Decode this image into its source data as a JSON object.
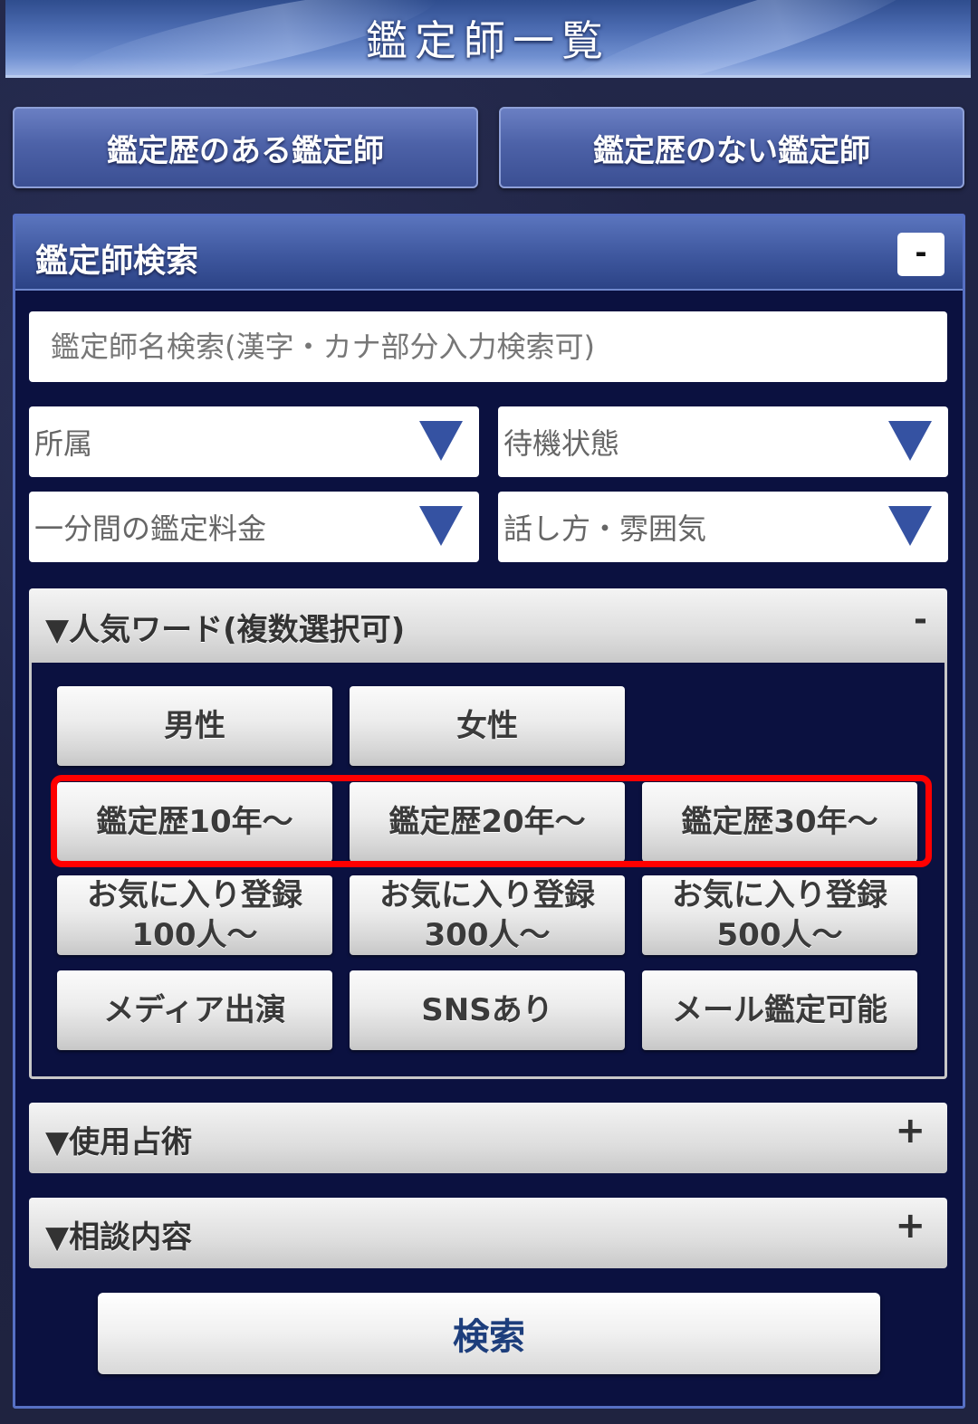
{
  "header": {
    "title": "鑑定師一覧"
  },
  "tabs": {
    "with_history": "鑑定歴のある鑑定師",
    "without_history": "鑑定歴のない鑑定師"
  },
  "search_panel": {
    "title": "鑑定師検索",
    "collapse_label": "-",
    "name_placeholder": "鑑定師名検索(漢字・カナ部分入力検索可)",
    "selects": {
      "affiliation": "所属",
      "status": "待機状態",
      "price": "一分間の鑑定料金",
      "style": "話し方・雰囲気"
    }
  },
  "popular_words": {
    "title": "▼人気ワード(複数選択可)",
    "toggle": "-",
    "buttons": {
      "male": "男性",
      "female": "女性",
      "exp10": "鑑定歴10年～",
      "exp20": "鑑定歴20年～",
      "exp30": "鑑定歴30年～",
      "fav100_line1": "お気に入り登録",
      "fav100_line2": "100人～",
      "fav300_line1": "お気に入り登録",
      "fav300_line2": "300人～",
      "fav500_line1": "お気に入り登録",
      "fav500_line2": "500人～",
      "media": "メディア出演",
      "sns": "SNSあり",
      "mail": "メール鑑定可能"
    }
  },
  "accordions": {
    "divination": {
      "title": "▼使用占術",
      "toggle": "+"
    },
    "consultation": {
      "title": "▼相談内容",
      "toggle": "+"
    }
  },
  "search_button": "検索",
  "colors": {
    "highlight": "#ff0000",
    "panel_bg": "#0b1140",
    "header_blue": "#4d6db3",
    "arrow_blue": "#3552a2"
  }
}
